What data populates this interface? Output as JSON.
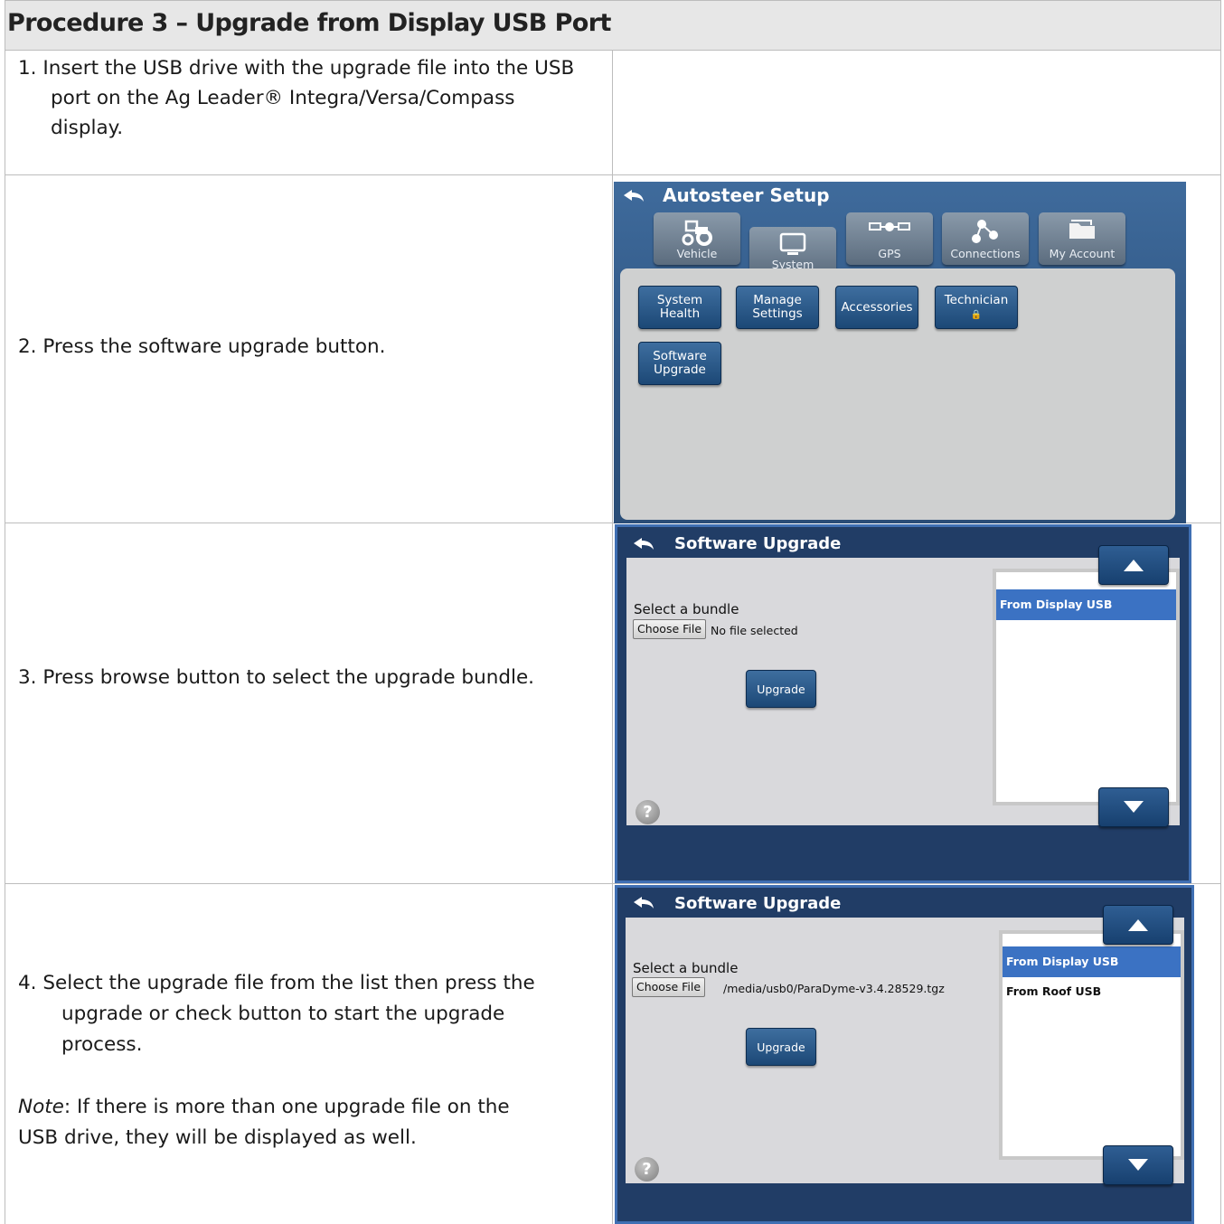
{
  "procedure": {
    "heading": "Procedure 3 – Upgrade from Display USB Port",
    "steps": [
      {
        "lines": [
          "1. Insert the USB drive with the upgrade file into the USB",
          "port on the Ag Leader® Integra/Versa/Compass",
          "display."
        ]
      },
      {
        "text": "2.  Press the software upgrade button."
      },
      {
        "text": "3.  Press browse button to select the upgrade bundle."
      },
      {
        "lines": [
          "4.  Select the upgrade file from the list then press the",
          "upgrade or check button to start the upgrade",
          "process."
        ],
        "note_label": "Note",
        "note_lines": [
          ": If there is more than one upgrade file on the",
          "USB drive, they will be displayed as well."
        ]
      }
    ]
  },
  "autosteer": {
    "title": "Autosteer Setup",
    "tabs": [
      {
        "label": "Vehicle",
        "icon": "tractor-icon"
      },
      {
        "label": "System",
        "icon": "monitor-icon",
        "selected": true
      },
      {
        "label": "GPS",
        "icon": "satellite-icon"
      },
      {
        "label": "Connections",
        "icon": "connections-icon"
      },
      {
        "label": "My Account",
        "icon": "folder-icon"
      }
    ],
    "buttons": [
      {
        "line1": "System",
        "line2": "Health"
      },
      {
        "line1": "Manage",
        "line2": "Settings"
      },
      {
        "line1": "Accessories",
        "line2": ""
      },
      {
        "line1": "Technician",
        "line2": "🔒"
      },
      {
        "line1": "Software",
        "line2": "Upgrade"
      }
    ]
  },
  "upgrade1": {
    "title": "Software Upgrade",
    "select_label": "Select a bundle",
    "choose_label": "Choose File",
    "file_status": "No file selected",
    "upgrade_label": "Upgrade",
    "list": [
      "From Display USB"
    ],
    "help": "?"
  },
  "upgrade2": {
    "title": "Software Upgrade",
    "select_label": "Select a bundle",
    "choose_label": "Choose File",
    "file_status": "/media/usb0/ParaDyme-v3.4.28529.tgz",
    "upgrade_label": "Upgrade",
    "list": [
      "From Display USB",
      "From Roof USB"
    ],
    "help": "?"
  },
  "colors": {
    "panel_blue": "#2e5481",
    "list_selected": "#3b72c3",
    "header_gray": "#e7e7e7"
  }
}
